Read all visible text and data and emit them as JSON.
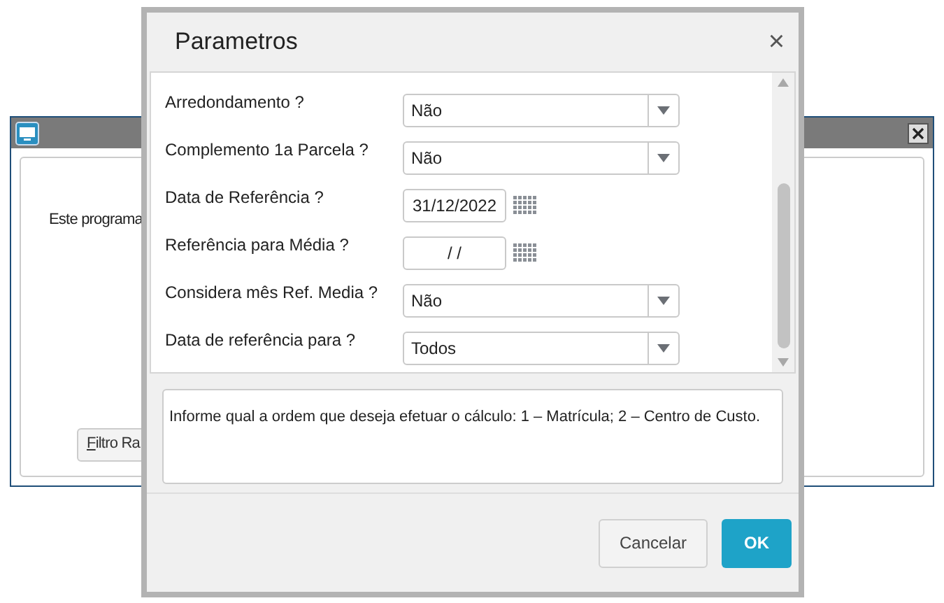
{
  "background_window": {
    "text": "Este programa",
    "button": "Filtro Ra"
  },
  "dialog": {
    "title": "Parametros",
    "close": "×",
    "fields": [
      {
        "kind": "select",
        "label": "Arredondamento ?",
        "value": "Não"
      },
      {
        "kind": "select",
        "label": "Complemento 1a Parcela ?",
        "value": "Não"
      },
      {
        "kind": "date",
        "label": "Data de Referência ?",
        "value": "31/12/2022"
      },
      {
        "kind": "date",
        "label": "Referência para Média ?",
        "value": "/ /"
      },
      {
        "kind": "select",
        "label": "Considera mês Ref. Media ?",
        "value": "Não"
      },
      {
        "kind": "select",
        "label": "Data de referência para ?",
        "value": "Todos"
      }
    ],
    "help": "Informe qual a ordem que deseja efetuar o cálculo: 1 – Matrícula; 2 – Centro de Custo.",
    "buttons": [
      {
        "kind": "secondary",
        "label": "Cancelar"
      },
      {
        "kind": "primary",
        "label": "OK"
      }
    ]
  }
}
